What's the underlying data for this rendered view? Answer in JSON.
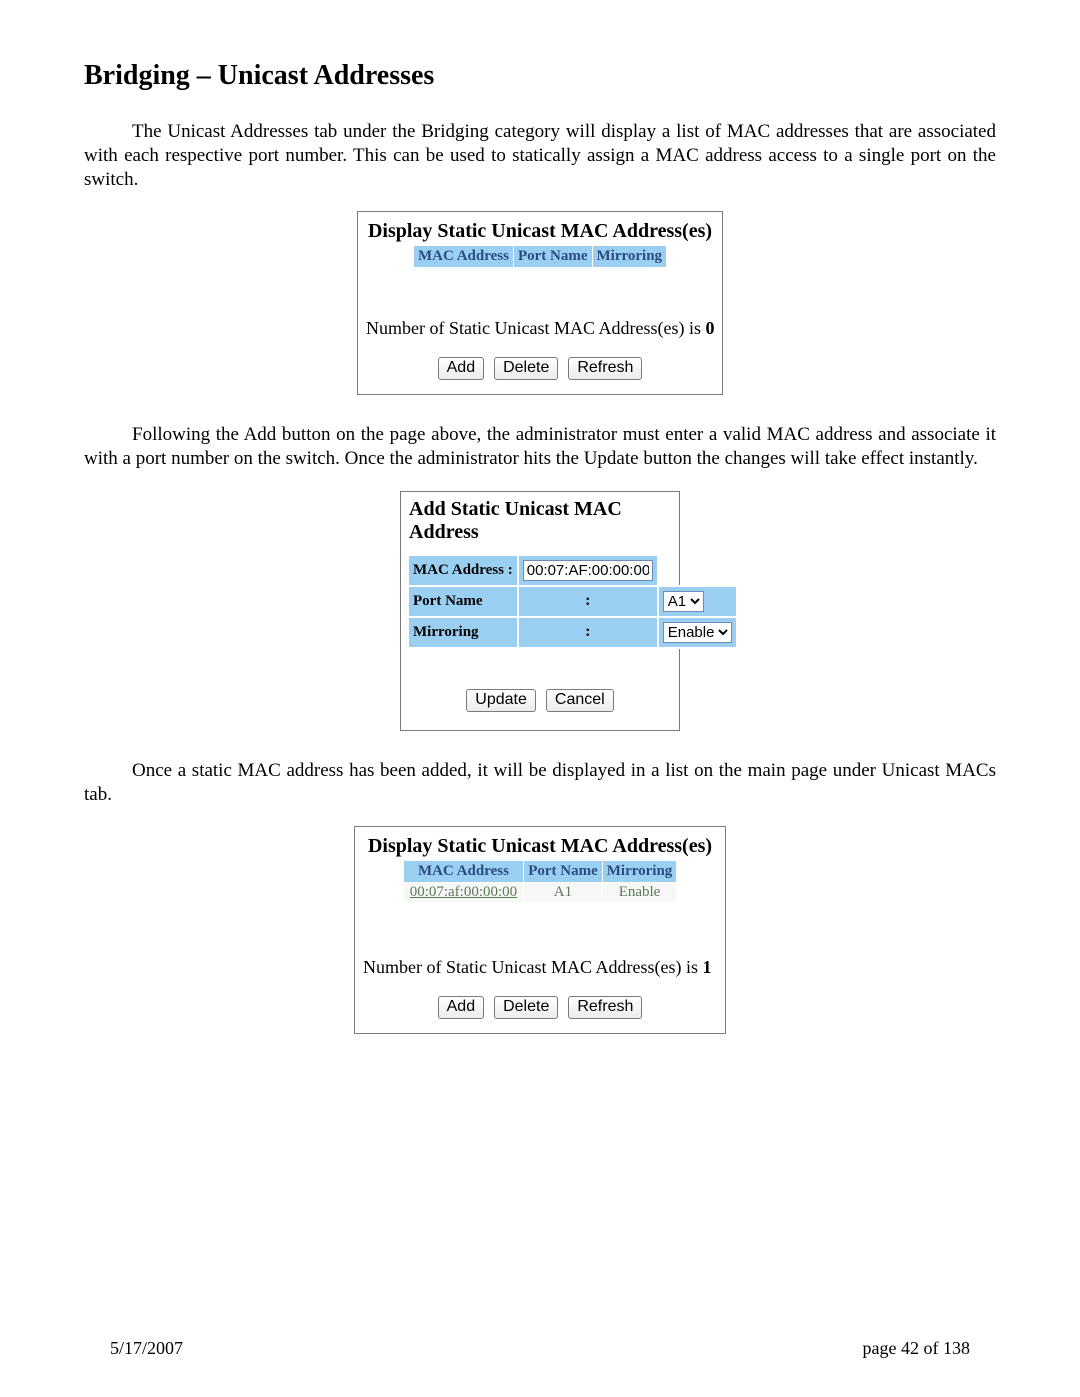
{
  "title": "Bridging – Unicast Addresses",
  "para1": "The Unicast Addresses tab under the Bridging category will display a list of MAC addresses that are associated with each respective port number.  This can be used to statically assign a MAC address access to a single port on the switch.",
  "panel_display_0": {
    "title": "Display Static Unicast MAC Address(es)",
    "headers": [
      "MAC Address",
      "Port Name",
      "Mirroring"
    ],
    "count_prefix": "Number of Static Unicast MAC Address(es) is ",
    "count": "0",
    "buttons": {
      "add": "Add",
      "delete": "Delete",
      "refresh": "Refresh"
    }
  },
  "para2": "Following the Add button on the page above, the administrator must enter a valid MAC address and associate it with a port number on the switch.  Once the administrator hits the Update button the changes will take effect instantly.",
  "panel_add": {
    "title": "Add Static Unicast MAC Address",
    "rows": {
      "mac_label": "MAC Address",
      "mac_value": "00:07:AF:00:00:00",
      "port_label": "Port Name",
      "port_value": "A1",
      "mirror_label": "Mirroring",
      "mirror_value": "Enable"
    },
    "buttons": {
      "update": "Update",
      "cancel": "Cancel"
    }
  },
  "para3": "Once a static MAC address has been added, it will be displayed in a list on the main page under Unicast MACs tab.",
  "panel_display_1": {
    "title": "Display Static Unicast MAC Address(es)",
    "headers": [
      "MAC Address",
      "Port Name",
      "Mirroring"
    ],
    "row": {
      "mac": "00:07:af:00:00:00",
      "port": "A1",
      "mirror": "Enable"
    },
    "count_prefix": "Number of Static Unicast MAC Address(es) is ",
    "count": "1",
    "buttons": {
      "add": "Add",
      "delete": "Delete",
      "refresh": "Refresh"
    }
  },
  "footer": {
    "date": "5/17/2007",
    "page": "page 42 of 138"
  }
}
